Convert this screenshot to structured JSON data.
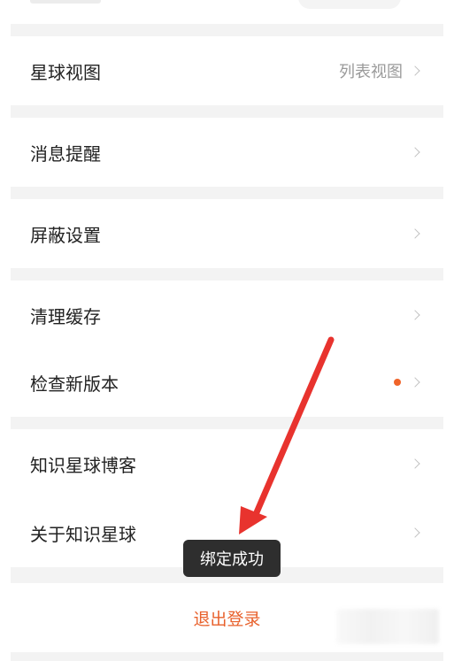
{
  "settings": {
    "planet_view": {
      "label": "星球视图",
      "value": "列表视图"
    },
    "notifications": {
      "label": "消息提醒"
    },
    "block_settings": {
      "label": "屏蔽设置"
    },
    "clear_cache": {
      "label": "清理缓存"
    },
    "check_update": {
      "label": "检查新版本",
      "badge_color": "#f0642a"
    },
    "blog": {
      "label": "知识星球博客"
    },
    "about": {
      "label": "关于知识星球"
    }
  },
  "logout": {
    "label": "退出登录",
    "color": "#e8612c"
  },
  "toast": {
    "text": "绑定成功"
  },
  "annotation": {
    "arrow_color": "#e8332e"
  }
}
